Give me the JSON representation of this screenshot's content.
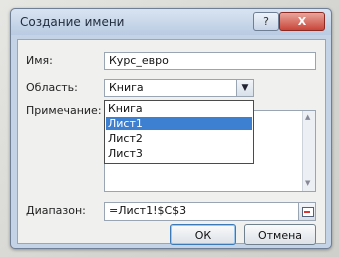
{
  "dialog": {
    "title": "Создание имени",
    "help_label": "?",
    "close_label": "X"
  },
  "form": {
    "name_label": "Имя:",
    "name_value": "Курс_евро",
    "scope_label": "Область:",
    "scope_value": "Книга",
    "comment_label": "Примечание:",
    "range_label": "Диапазон:",
    "range_value": "=Лист1!$C$3"
  },
  "scope_dropdown": {
    "options": [
      "Книга",
      "Лист1",
      "Лист2",
      "Лист3"
    ],
    "highlighted": "Лист1"
  },
  "buttons": {
    "ok_label": "ОК",
    "cancel_label": "Отмена"
  },
  "colors": {
    "selection": "#3d7fd1",
    "close_button": "#c9463b",
    "window_frame": "#c5d3e6"
  }
}
